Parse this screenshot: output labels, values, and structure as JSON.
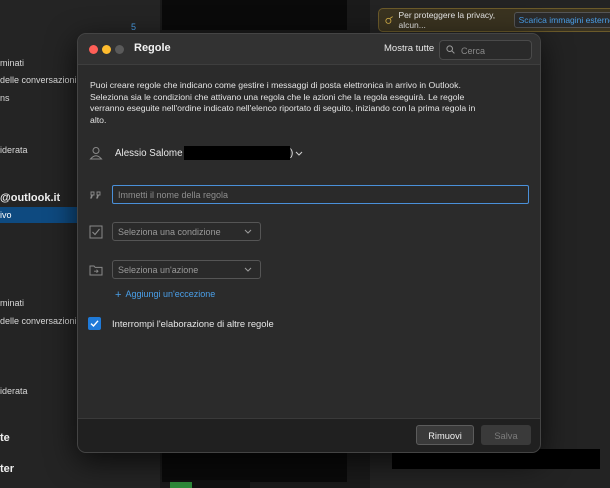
{
  "background": {
    "sidebar": {
      "badge": "5",
      "items": [
        {
          "label": "minati"
        },
        {
          "label": "delle conversazioni"
        },
        {
          "label": "ns"
        },
        {
          "label": "iderata"
        },
        {
          "label": "@outlook.it"
        },
        {
          "label": "ivo"
        },
        {
          "label": "minati"
        },
        {
          "label": "delle conversazioni"
        },
        {
          "label": "iderata"
        },
        {
          "label": "te"
        },
        {
          "label": "ter"
        }
      ]
    },
    "privacy_bar": {
      "text": "Per proteggere la privacy, alcun...",
      "button": "Scarica immagini esterne"
    }
  },
  "dialog": {
    "title": "Regole",
    "show_all": "Mostra tutte",
    "search_placeholder": "Cerca",
    "description": "Puoi creare regole che indicano come gestire i messaggi di posta elettronica in arrivo in Outlook. Seleziona sia le condizioni che attivano una regola che le azioni che la regola eseguirà. Le regole verranno eseguite nell'ordine indicato nell'elenco riportato di seguito, iniziando con la prima regola in alto.",
    "account_name": "Alessio Salome (",
    "account_close": ")",
    "rule_name_placeholder": "Immetti il nome della regola",
    "condition_select": "Seleziona una condizione",
    "action_select": "Seleziona un'azione",
    "add_exception": "Aggiungi un'eccezione",
    "stop_processing_label": "Interrompi l'elaborazione di altre regole",
    "stop_processing_checked": true,
    "remove_button": "Rimuovi",
    "save_button": "Salva"
  },
  "colors": {
    "accent": "#1f7ad8",
    "link": "#4a9fe8",
    "dialog_bg": "#2b2b2b"
  }
}
